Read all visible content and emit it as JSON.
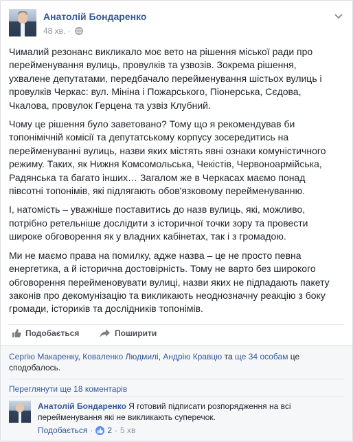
{
  "post": {
    "author": "Анатолій Бондаренко",
    "time": "48 хв.",
    "dot": "·",
    "paragraphs": [
      "Чималий резонанс викликало моє вето на рішення міської ради про перейменування вулиць, провулків та узвозів. Зокрема рішення, ухвалене депутатами, передбачало перейменування шістьох вулиць і провулків Черкас: вул. Мініна і Пожарського, Піонерська, Сєдова, Чкалова, провулок Герцена та узвіз Клубний.",
      "Чому це рішення було заветовано? Тому що я рекомендував би топонімічній комісії та депутатському корпусу зосередитись на перейменуванні вулиць, назви яких містять явні ознаки комуністичного режиму. Таких, як Нижня Комсомольська, Чекістів, Червоноармійська, Радянська та багато інших… Загалом же в Черкасах маємо понад півсотні топонімів, які підлягають обов'язковому перейменуванню.",
      "І, натомість – уважніше поставитись до назв вулиць, які, можливо, потрібно ретельніше дослідити з історичної точки зору та провести широке обговорення як у владних кабінетах, так і з громадою.",
      "Ми не маємо права на помилку, адже назва – це не просто певна енергетика, а й історична достовірність. Тому не варто без широкого обговорення перейменовувати вулиці, назви яких не підпадають пакету законів про декомунізацію та викликають неоднозначну реакцію з боку громади, істориків та дослідників топонімів."
    ]
  },
  "actions": {
    "like_label": "Подобається",
    "share_label": "Поширити"
  },
  "likes": {
    "names": [
      "Сергію Макаренку",
      "Коваленко Людмилі",
      "Андрію Кравцю"
    ],
    "sep": ", ",
    "and": " та ",
    "others": "ще 34 особам",
    "suffix": " це сподобалось."
  },
  "comments": {
    "more_label": "Переглянути ще 18 коментарів",
    "items": [
      {
        "author": "Анатолій Бондаренко",
        "text": "Я готовий підписати розпорядження на всі перейменування які не викликають суперечок.",
        "like_label": "Подобається",
        "dot": "·",
        "like_count": "2",
        "time": "5 хв"
      }
    ]
  },
  "icons": {
    "chevron": "chevron-down-icon",
    "globe": "globe-icon",
    "like": "thumbs-up-icon",
    "share": "share-arrow-icon"
  },
  "colors": {
    "link": "#365899",
    "meta": "#90949c",
    "text": "#1d2129",
    "feedback_bg": "#f6f7f9"
  }
}
